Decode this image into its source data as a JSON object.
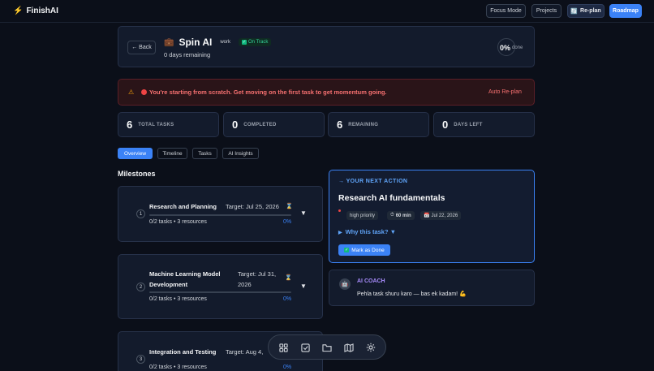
{
  "nav": {
    "brand": "FinishAI",
    "focus_mode": "Focus Mode",
    "projects": "Projects",
    "replan": "Re-plan",
    "roadmap": "Roadmap"
  },
  "project": {
    "back": "← Back",
    "icon": "briefcase-icon",
    "name": "Spin AI",
    "category": "work",
    "status": "On Track",
    "days_remaining": "0 days remaining",
    "percent": "0%",
    "percent_label": "done"
  },
  "alert": {
    "message": "You're starting from scratch. Get moving on the first task to get momentum going.",
    "action": "Auto Re-plan"
  },
  "stats": [
    {
      "value": "6",
      "label": "TOTAL TASKS"
    },
    {
      "value": "0",
      "label": "COMPLETED"
    },
    {
      "value": "6",
      "label": "REMAINING"
    },
    {
      "value": "0",
      "label": "DAYS LEFT"
    }
  ],
  "tabs": [
    "Overview",
    "Timeline",
    "Tasks",
    "AI Insights"
  ],
  "milestones_title": "Milestones",
  "milestones": [
    {
      "num": "1",
      "title": "Research and Planning",
      "target": "Target: Jul 25, 2026",
      "tasks": "0/2 tasks • 3 resources",
      "percent": "0%",
      "progress": 0
    },
    {
      "num": "2",
      "title": "Machine Learning Model Development",
      "target": "Target: Jul 31, 2026",
      "tasks": "0/2 tasks • 3 resources",
      "percent": "0%",
      "progress": 0
    },
    {
      "num": "3",
      "title": "Integration and Testing",
      "target": "Target: Aug 4,",
      "tasks": "0/2 tasks • 3 resources",
      "percent": "0%",
      "progress": 0
    }
  ],
  "next_action": {
    "label": "→ YOUR NEXT ACTION",
    "title": "Research AI fundamentals",
    "priority": "high priority",
    "duration": "60 min",
    "date": "Jul 22, 2026",
    "why": "Why this task? ▼",
    "done": "Mark as Done"
  },
  "coach": {
    "label": "AI COACH",
    "message": "Pehla task shuru karo — bas ek kadam! 💪"
  },
  "dock": [
    "grid-icon",
    "tasks-check-icon",
    "folder-icon",
    "map-icon",
    "settings-gear-icon"
  ],
  "colors": {
    "accent": "#3b82f6",
    "background": "#0b0f19",
    "danger": "#ef4444",
    "success": "#10b981",
    "coach": "#a78bfa"
  }
}
